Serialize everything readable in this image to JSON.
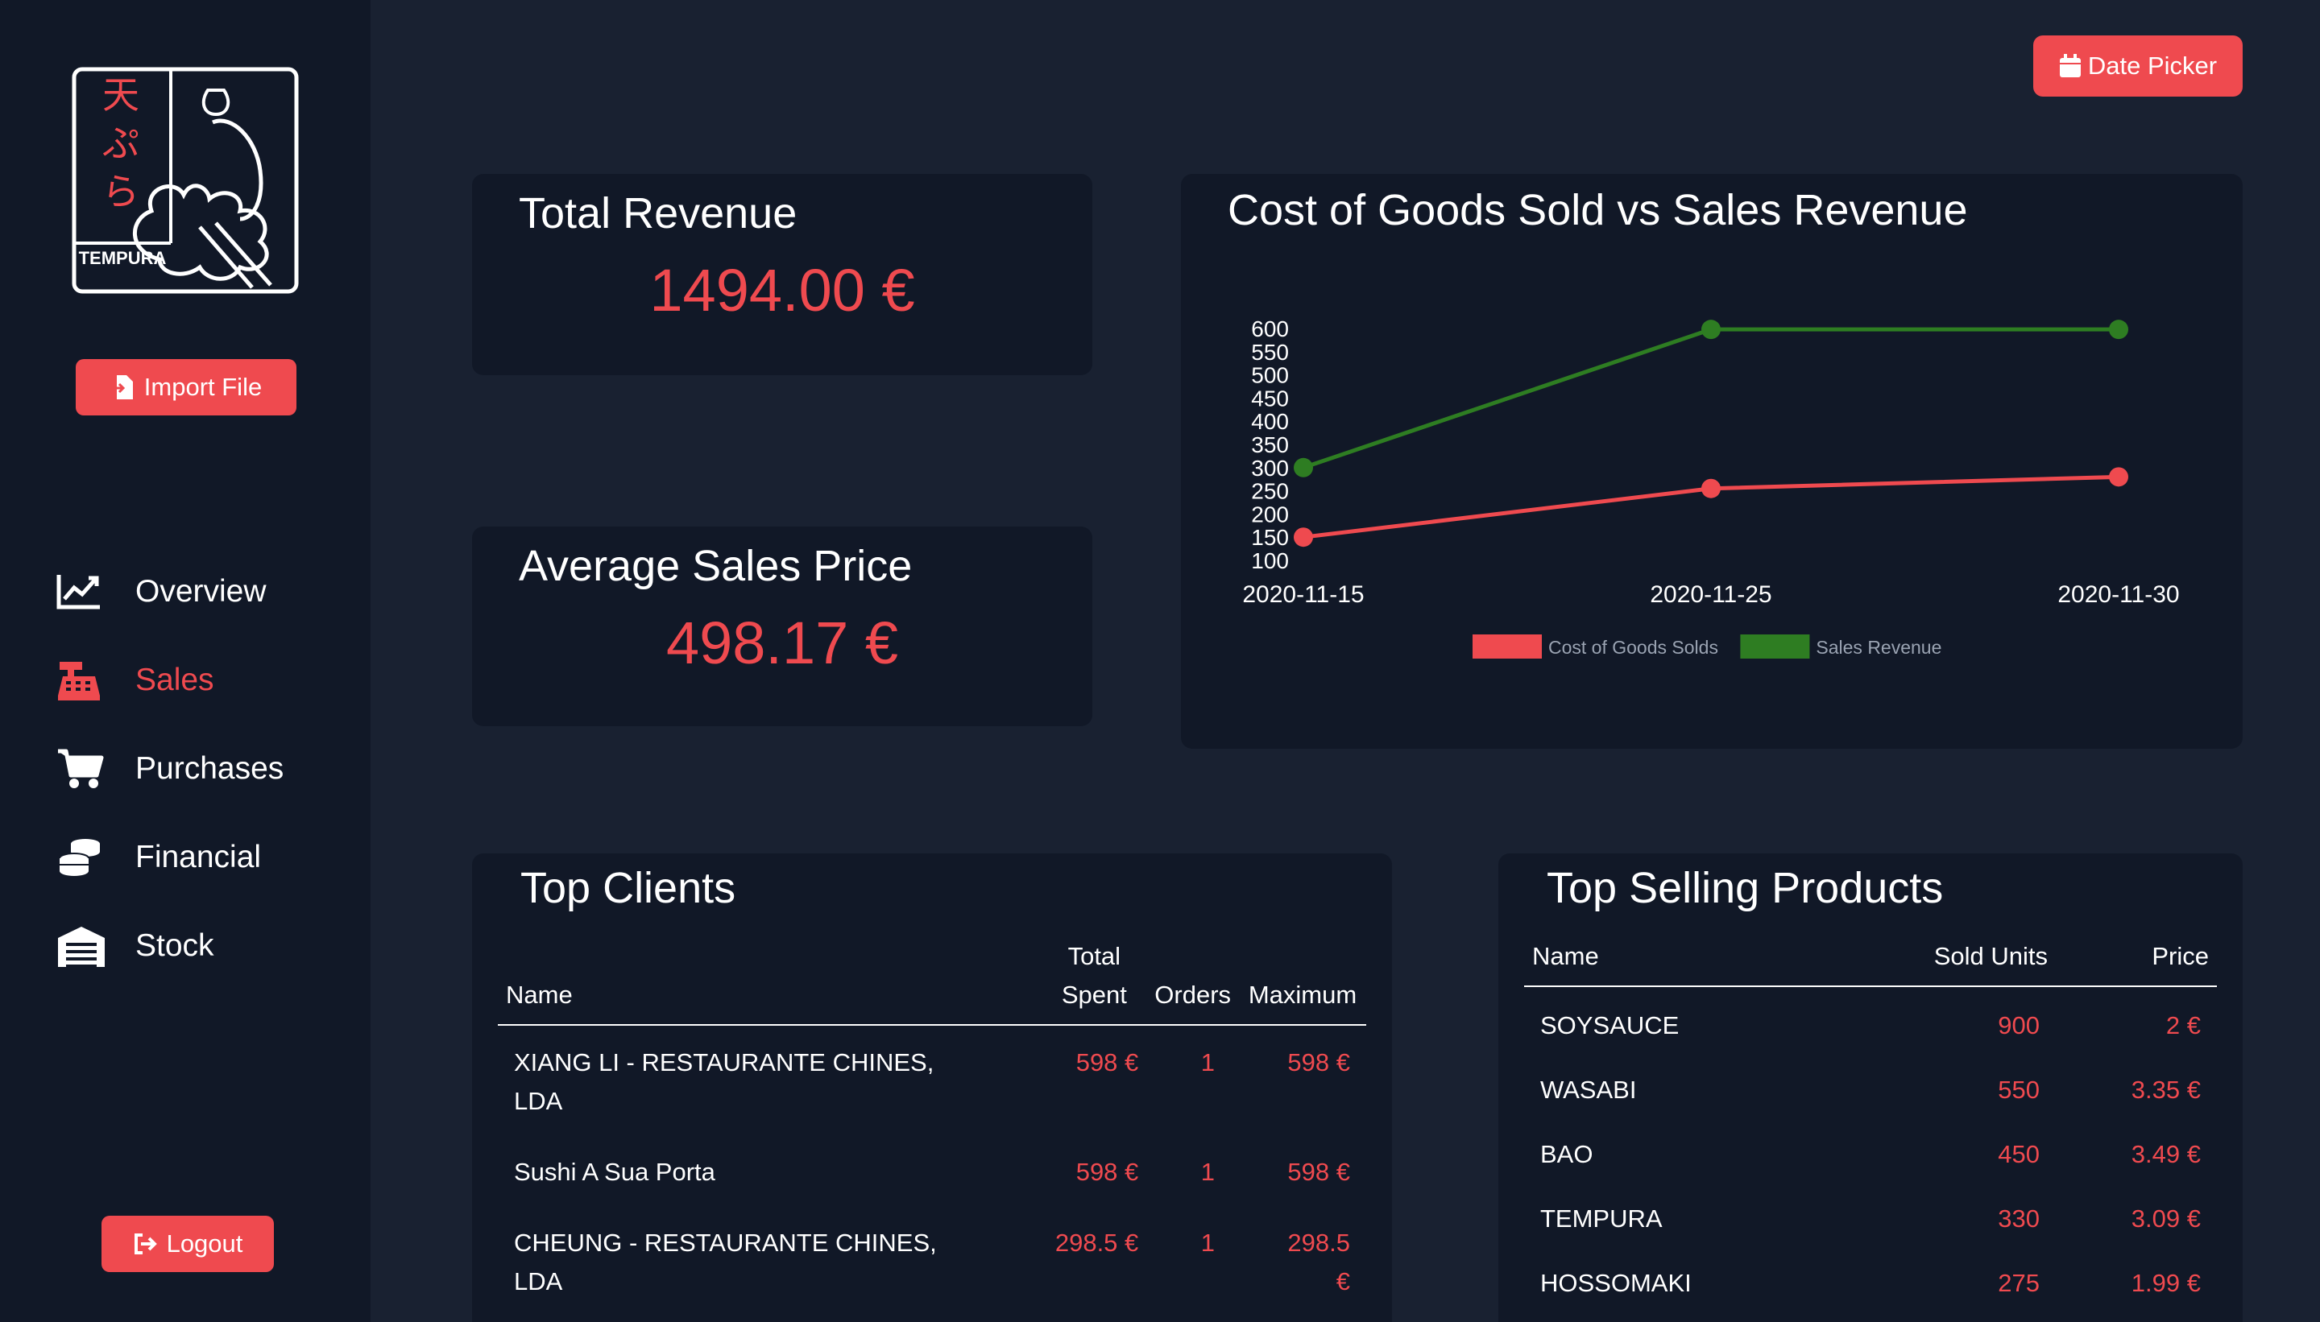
{
  "brand": {
    "logo_text": "TEMPURA",
    "logo_kana": "天ぷら",
    "accent": "#ef4a4f",
    "bg": "#192131",
    "panel": "#111827"
  },
  "sidebar": {
    "import_label": "Import File",
    "items": [
      {
        "label": "Overview",
        "icon": "chart-line-icon",
        "active": false
      },
      {
        "label": "Sales",
        "icon": "cash-register-icon",
        "active": true
      },
      {
        "label": "Purchases",
        "icon": "shopping-cart-icon",
        "active": false
      },
      {
        "label": "Financial",
        "icon": "coins-icon",
        "active": false
      },
      {
        "label": "Stock",
        "icon": "warehouse-icon",
        "active": false
      }
    ],
    "logout_label": "Logout"
  },
  "header": {
    "date_picker_label": "Date Picker"
  },
  "kpis": {
    "total_revenue": {
      "title": "Total Revenue",
      "value": "1494.00 €"
    },
    "avg_sales_price": {
      "title": "Average Sales Price",
      "value": "498.17 €"
    }
  },
  "chart_data": {
    "type": "line",
    "title": "Cost of Goods Sold vs Sales Revenue",
    "categories": [
      "2020-11-15",
      "2020-11-25",
      "2020-11-30"
    ],
    "x": [
      "2020-11-15",
      "2020-11-25",
      "2020-11-30"
    ],
    "series": [
      {
        "name": "Cost of Goods Solds",
        "values": [
          150,
          255,
          280
        ],
        "color": "#ef4a4f"
      },
      {
        "name": "Sales Revenue",
        "values": [
          300,
          598,
          598
        ],
        "color": "#2e7d22"
      }
    ],
    "ylim": [
      100,
      600
    ],
    "yticks": [
      "600",
      "550",
      "500",
      "450",
      "400",
      "350",
      "300",
      "250",
      "200",
      "150",
      "100"
    ],
    "grid": false,
    "legend": "bottom"
  },
  "top_clients": {
    "title": "Top Clients",
    "columns": {
      "name": "Name",
      "total_line1": "Total",
      "total_line2": "Spent",
      "orders": "Orders",
      "maximum": "Maximum"
    },
    "rows": [
      {
        "name": "XIANG LI - RESTAURANTE CHINES, LDA",
        "total": "598 €",
        "orders": "1",
        "maximum": "598 €"
      },
      {
        "name": "Sushi A Sua Porta",
        "total": "598 €",
        "orders": "1",
        "maximum": "598 €"
      },
      {
        "name": "CHEUNG - RESTAURANTE CHINES, LDA",
        "total": "298.5 €",
        "orders": "1",
        "maximum": "298.5 €"
      }
    ]
  },
  "top_products": {
    "title": "Top Selling Products",
    "columns": {
      "name": "Name",
      "sold": "Sold Units",
      "price": "Price"
    },
    "rows": [
      {
        "name": "SOYSAUCE",
        "sold": "900",
        "price": "2 €"
      },
      {
        "name": "WASABI",
        "sold": "550",
        "price": "3.35 €"
      },
      {
        "name": "BAO",
        "sold": "450",
        "price": "3.49 €"
      },
      {
        "name": "TEMPURA",
        "sold": "330",
        "price": "3.09 €"
      },
      {
        "name": "HOSSOMAKI",
        "sold": "275",
        "price": "1.99 €"
      }
    ]
  }
}
